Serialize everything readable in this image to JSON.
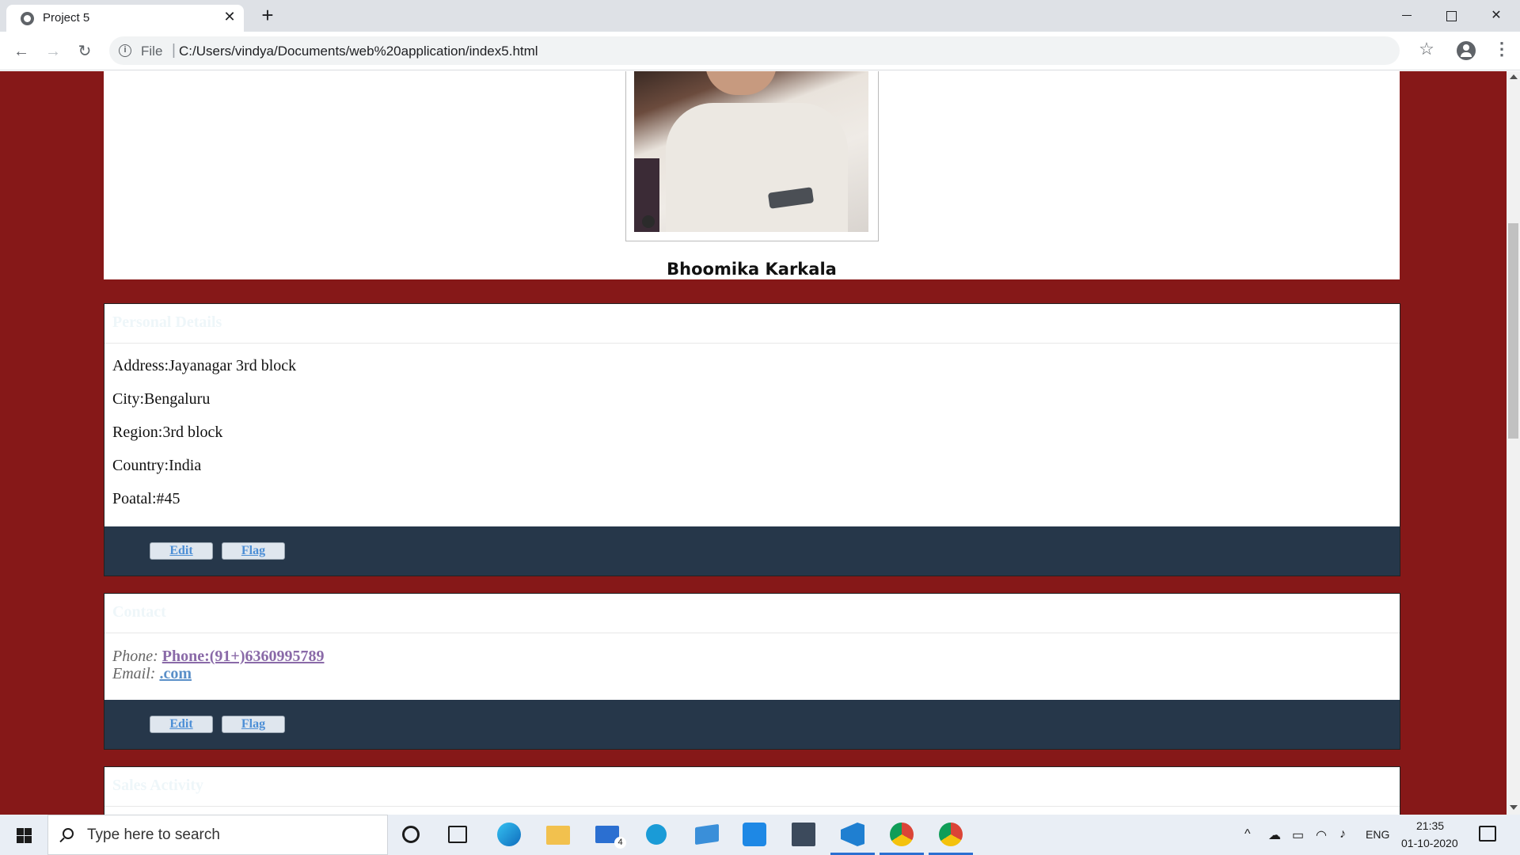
{
  "browser": {
    "tab_title": "Project 5",
    "tab_close": "✕",
    "new_tab": "+",
    "url_scheme": "File",
    "url_separator": "|",
    "url": "C:/Users/vindya/Documents/web%20application/index5.html"
  },
  "profile": {
    "name": "Bhoomika Karkala"
  },
  "personal_card": {
    "header": "Personal Details",
    "lines": [
      "Address:Jayanagar 3rd block",
      "City:Bengaluru",
      "Region:3rd block",
      "Country:India",
      "Poatal:#45"
    ],
    "edit_label": "Edit",
    "flag_label": "Flag"
  },
  "contact_card": {
    "header": "Contact",
    "phone_label": "Phone:",
    "phone_value": "Phone:(91+)6360995789",
    "email_label": "Email:",
    "email_value": ".com",
    "edit_label": "Edit",
    "flag_label": "Flag"
  },
  "next_card": {
    "header": "Sales Activity"
  },
  "taskbar": {
    "search_placeholder": "Type here to search",
    "mail_badge": "4",
    "language": "ENG",
    "time": "21:35",
    "date": "01-10-2020"
  },
  "colors": {
    "page_background": "#861818",
    "card_footer": "#26374a",
    "link_blue": "#4d8fd6"
  }
}
